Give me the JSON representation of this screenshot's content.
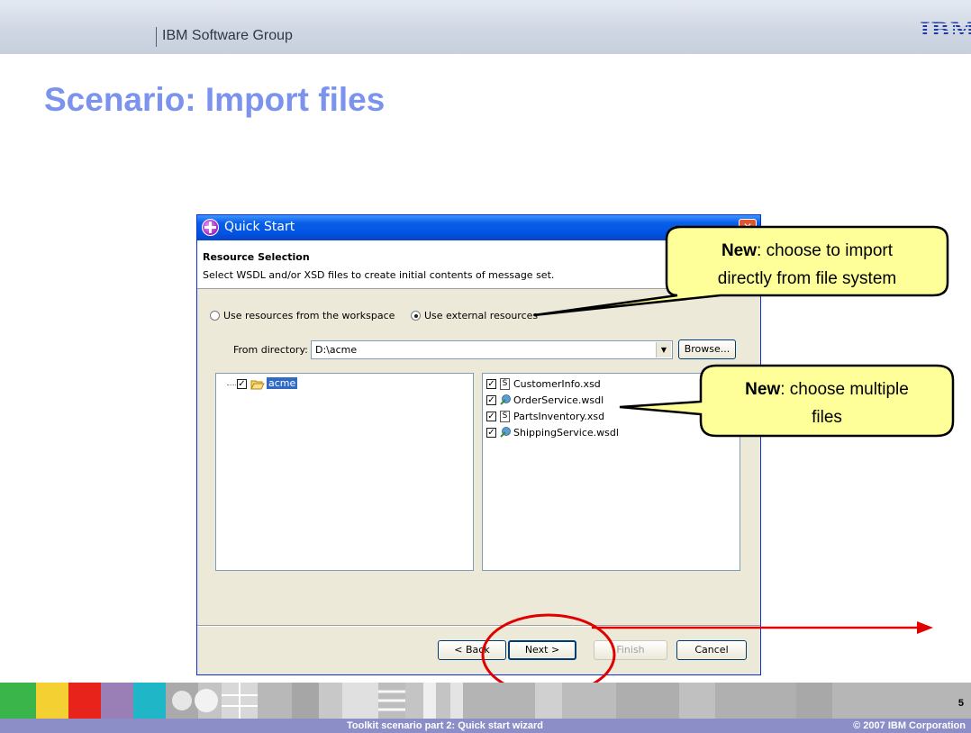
{
  "slide": {
    "group": "IBM Software Group",
    "logo": "IBM",
    "title": "Scenario: Import files",
    "page_number": "5",
    "footer_left": "Toolkit scenario part 2:  Quick start wizard",
    "footer_right": "© 2007 IBM Corporation"
  },
  "dialog": {
    "title": "Quick Start",
    "section_title": "Resource Selection",
    "description": "Select WSDL and/or XSD files to create initial contents of message set.",
    "radio_workspace": "Use resources from the workspace",
    "radio_external": "Use external resources",
    "selected_radio": "external",
    "directory_label": "From directory:",
    "directory_value": "D:\\acme",
    "browse_label": "Browse...",
    "tree_folder": "acme",
    "files": [
      {
        "name": "CustomerInfo.xsd",
        "type": "xsd",
        "checked": true
      },
      {
        "name": "OrderService.wsdl",
        "type": "wsdl",
        "checked": true
      },
      {
        "name": "PartsInventory.xsd",
        "type": "xsd",
        "checked": true
      },
      {
        "name": "ShippingService.wsdl",
        "type": "wsdl",
        "checked": true
      }
    ],
    "buttons": {
      "back": "< Back",
      "next": "Next >",
      "finish": "Finish",
      "cancel": "Cancel"
    }
  },
  "callouts": [
    {
      "bold": "New",
      "line1_rest": ": choose to import",
      "line2": "directly from file system"
    },
    {
      "bold": "New",
      "line1_rest": ": choose multiple",
      "line2": "files"
    }
  ],
  "colors": {
    "title": "#7b93ec",
    "callout_fill": "#ffff99",
    "annotation_red": "#e00000",
    "footer": "#8c8ec8"
  }
}
